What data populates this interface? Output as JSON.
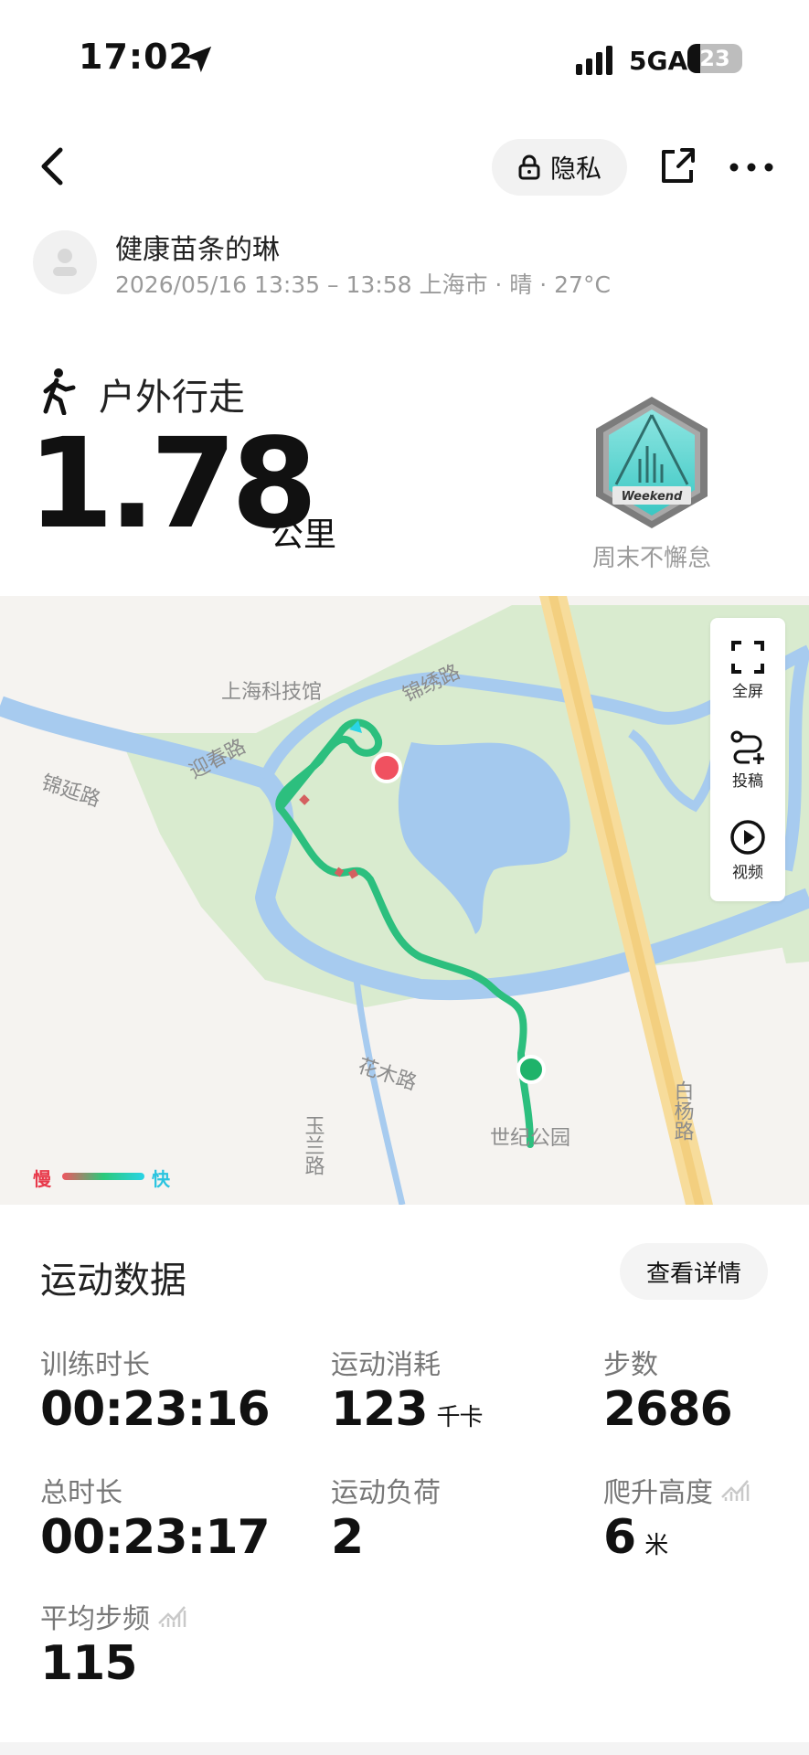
{
  "status_bar": {
    "time": "17:02",
    "network": "5GA",
    "battery": "23"
  },
  "header": {
    "privacy_label": "隐私"
  },
  "user": {
    "name": "健康苗条的琳",
    "meta": "2026/05/16 13:35 – 13:58 上海市 · 晴 · 27°C"
  },
  "activity": {
    "type": "户外行走",
    "distance": "1.78",
    "distance_unit": "公里"
  },
  "badge": {
    "title": "周末不懈怠",
    "inner_text": "Weekend"
  },
  "map": {
    "labels": [
      "上海科技馆",
      "锦绣路",
      "迎春路",
      "锦延路",
      "花木路",
      "世纪公园",
      "白杨路",
      "玉兰路"
    ],
    "tools": [
      "全屏",
      "投稿",
      "视频"
    ],
    "legend_slow": "慢",
    "legend_fast": "快"
  },
  "stats": {
    "title": "运动数据",
    "detail_button": "查看详情",
    "items": [
      {
        "label": "训练时长",
        "value": "00:23:16",
        "unit": ""
      },
      {
        "label": "运动消耗",
        "value": "123",
        "unit": "千卡"
      },
      {
        "label": "步数",
        "value": "2686",
        "unit": ""
      },
      {
        "label": "总时长",
        "value": "00:23:17",
        "unit": ""
      },
      {
        "label": "运动负荷",
        "value": "2",
        "unit": ""
      },
      {
        "label": "爬升高度",
        "value": "6",
        "unit": "米"
      },
      {
        "label": "平均步频",
        "value": "115",
        "unit": ""
      }
    ]
  }
}
